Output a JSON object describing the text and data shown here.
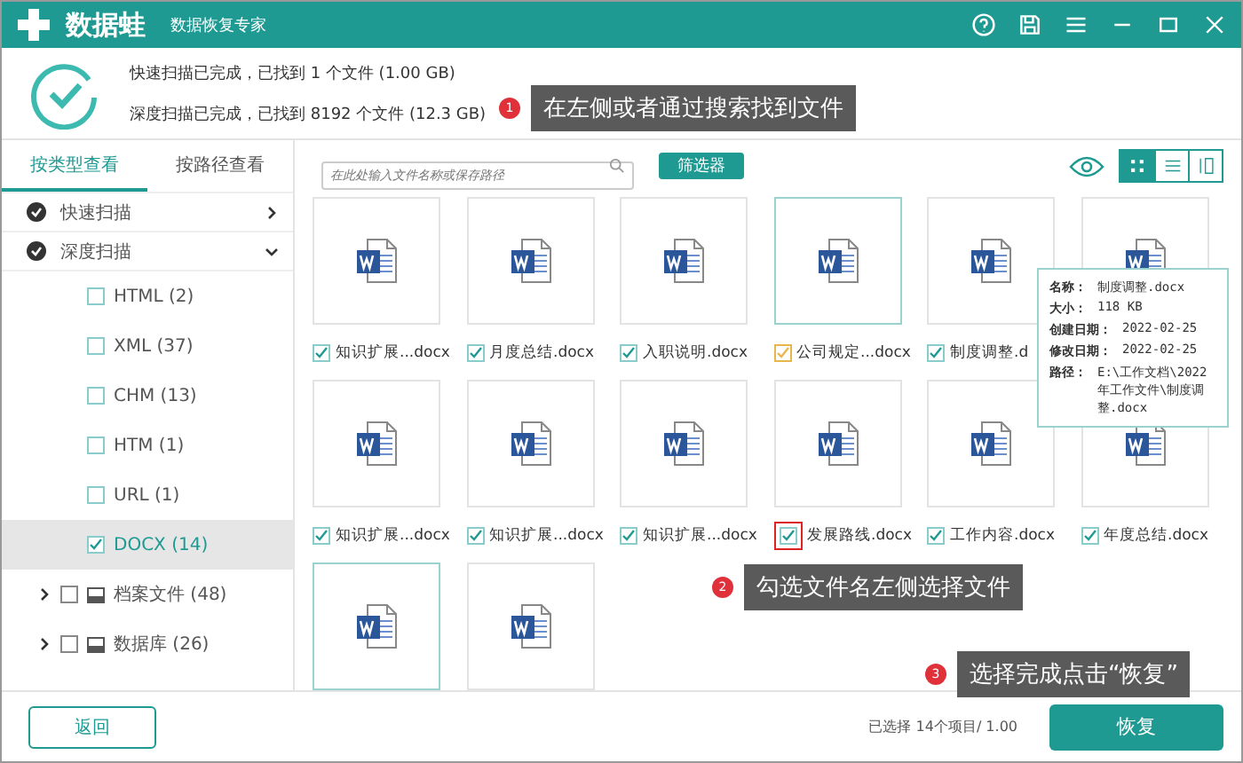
{
  "app": {
    "name": "数据蛙",
    "subtitle": "数据恢复专家"
  },
  "scan_summary": {
    "lines": [
      "快速扫描已完成，已找到 1 个文件 (1.00 GB)",
      "深度扫描已完成，已找到 8192 个文件 (12.3 GB)"
    ]
  },
  "sidebar": {
    "tabs": [
      {
        "label": "按类型查看",
        "selected": true
      },
      {
        "label": "按路径查看",
        "selected": false
      }
    ],
    "scans": [
      {
        "label": "快速扫描",
        "expanded": false
      },
      {
        "label": "深度扫描",
        "expanded": true,
        "children": [
          {
            "kind": "type",
            "label": "HTML (2)",
            "checked": false,
            "selected": false
          },
          {
            "kind": "type",
            "label": "XML (37)",
            "checked": false,
            "selected": false
          },
          {
            "kind": "type",
            "label": "CHM (13)",
            "checked": false,
            "selected": false
          },
          {
            "kind": "type",
            "label": "HTM (1)",
            "checked": false,
            "selected": false
          },
          {
            "kind": "type",
            "label": "URL (1)",
            "checked": false,
            "selected": false
          },
          {
            "kind": "type",
            "label": "DOCX (14)",
            "checked": true,
            "selected": true
          },
          {
            "kind": "category",
            "label": "档案文件 (48)",
            "checked": false,
            "selected": false,
            "expanded": false
          },
          {
            "kind": "category",
            "label": "数据库 (26)",
            "checked": false,
            "selected": false,
            "expanded": false
          }
        ]
      }
    ]
  },
  "toolbar": {
    "search": {
      "placeholder": "在此处输入文件名称或保存路径"
    },
    "filter_button": "筛选器",
    "views": [
      {
        "kind": "grid",
        "selected": true
      },
      {
        "kind": "list",
        "selected": false
      },
      {
        "kind": "detail",
        "selected": false
      }
    ]
  },
  "files": [
    {
      "name": "知识扩展...docx",
      "checked": true,
      "highlighted": false
    },
    {
      "name": "月度总结.docx",
      "checked": true,
      "highlighted": false
    },
    {
      "name": "入职说明.docx",
      "checked": true,
      "highlighted": false
    },
    {
      "name": "公司规定...docx",
      "checked": true,
      "highlighted": true,
      "color": "#e8b64c"
    },
    {
      "name": "制度调整.d",
      "checked": true,
      "highlighted": false
    },
    {
      "highlighted": false
    },
    {
      "name": "知识扩展...docx",
      "checked": true,
      "highlighted": false
    },
    {
      "name": "知识扩展...docx",
      "checked": true,
      "highlighted": false
    },
    {
      "name": "知识扩展...docx",
      "checked": true,
      "highlighted": false
    },
    {
      "name": "发展路线.docx",
      "checked": true,
      "highlighted": false,
      "outlined": true
    },
    {
      "name": "工作内容.docx",
      "checked": true,
      "highlighted": false
    },
    {
      "name": "年度总结.docx",
      "checked": true,
      "highlighted": false
    },
    {
      "highlighted": true
    },
    {
      "highlighted": false
    }
  ],
  "tooltip": {
    "rows": [
      {
        "label": "名称：",
        "value": "制度调整.docx"
      },
      {
        "label": "大小：",
        "value": "118 KB"
      },
      {
        "label": "创建日期：",
        "value": "2022-02-25"
      },
      {
        "label": "修改日期：",
        "value": "2022-02-25"
      },
      {
        "label": "路径：",
        "value": "E:\\工作文档\\2022年工作文件\\制度调整.docx"
      }
    ]
  },
  "callouts": [
    {
      "number": "1",
      "text": "在左侧或者通过搜索找到文件"
    },
    {
      "number": "2",
      "text": "勾选文件名左侧选择文件"
    },
    {
      "number": "3",
      "text": "选择完成点击“恢复”"
    }
  ],
  "footer": {
    "back_button": "返回",
    "status": "已选择 14个项目/ 1.00",
    "restore_button": "恢复"
  }
}
